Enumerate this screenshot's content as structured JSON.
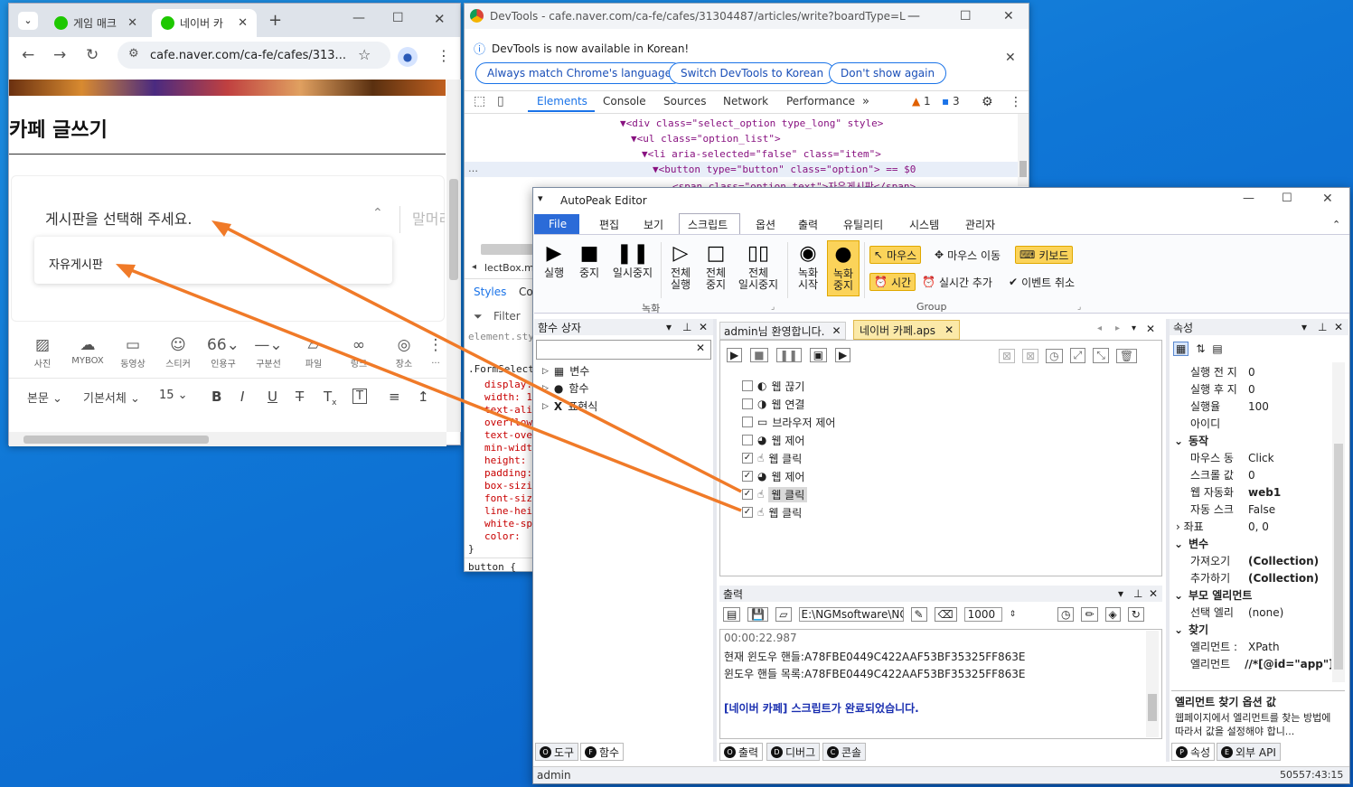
{
  "chrome": {
    "tab1": "게임 매크",
    "tab2": "네이버 카",
    "url": "cafe.naver.com/ca-fe/cafes/313...",
    "page_title": "카페 글쓰기",
    "board_placeholder": "게시판을 선택해 주세요.",
    "side_text": "말머리",
    "dropdown_option": "자유게시판",
    "tools": [
      "사진",
      "MYBOX",
      "동영상",
      "스티커",
      "인용구",
      "구분선",
      "파일",
      "링크",
      "장소",
      "..."
    ],
    "format": {
      "style": "본문",
      "font": "기본서체",
      "size": "15"
    }
  },
  "devtools": {
    "title": "DevTools - cafe.naver.com/ca-fe/cafes/31304487/articles/write?boardType=L",
    "notice": "DevTools is now available in Korean!",
    "btn1": "Always match Chrome's language",
    "btn2": "Switch DevTools to Korean",
    "btn3": "Don't show again",
    "tabs": [
      "Elements",
      "Console",
      "Sources",
      "Network",
      "Performance"
    ],
    "warn_count": "1",
    "msg_count": "3",
    "code": [
      "▼<div class=\"select_option type_long\" style>",
      "▼<ul class=\"option_list\">",
      "▼<li aria-selected=\"false\" class=\"item\">",
      "▼<button type=\"button\" class=\"option\"> == $0",
      "<span class=\"option_text\">자유게시판</span>"
    ],
    "crumb": "lectBox.m",
    "styles_tab": "Styles",
    "co_tab": "Co",
    "filter": "Filter",
    "element_style": "element.styl",
    "selector": ".FormSelectB",
    "css_props": [
      "display:",
      "width: 10",
      "text-alig",
      "overflow:",
      "text-over",
      "min-width",
      "height: ",
      "padding:",
      "box-sizin",
      "font-size",
      "line-heig",
      "white-spa",
      "color: "
    ],
    "close_brace": "}",
    "button_rule": "button {"
  },
  "autopeak": {
    "title": "AutoPeak Editor",
    "menu": [
      "File",
      "편집",
      "보기",
      "스크립트",
      "옵션",
      "출력",
      "유틸리티",
      "시스템",
      "관리자"
    ],
    "ribbon": {
      "run": "실행",
      "stop": "중지",
      "pause": "일시중지",
      "all_run": "전체\n실행",
      "all_stop": "전체\n중지",
      "all_pause": "전체\n일시중지",
      "rec_start": "녹화\n시작",
      "rec_stop": "녹화\n중지",
      "mouse": "마우스",
      "mouse_move": "마우스 이동",
      "keyboard": "키보드",
      "time": "시간",
      "realtime_add": "실시간 추가",
      "event_cancel": "이벤트 취소",
      "group_rec": "녹화",
      "group_group": "Group"
    },
    "func_box": {
      "title": "함수 상자",
      "items": [
        "변수",
        "함수",
        "표현식"
      ]
    },
    "doc_tabs": [
      "admin님 환영합니다.",
      "네이버 카페.aps"
    ],
    "script_items": [
      {
        "label": "웹 끊기",
        "checked": false
      },
      {
        "label": "웹 연결",
        "checked": false
      },
      {
        "label": "브라우저 제어",
        "checked": false
      },
      {
        "label": "웹 제어",
        "checked": false
      },
      {
        "label": "웹 클릭",
        "checked": true
      },
      {
        "label": "웹 제어",
        "checked": true
      },
      {
        "label": "웹 클릭",
        "checked": true
      },
      {
        "label": "웹 클릭",
        "checked": true
      }
    ],
    "output": {
      "title": "출력",
      "path": "E:\\NGMsoftware\\NG",
      "count": "1000",
      "lines": [
        "00:00:22.987",
        "현재 윈도우 핸들:A78FBE0449C422AAF53BF35325FF863E",
        "윈도우 핸들 목록:A78FBE0449C422AAF53BF35325FF863E",
        "",
        "[네이버 카페] 스크립트가 완료되었습니다."
      ]
    },
    "props": {
      "title": "속성",
      "rows_top": [
        [
          "실행 전 지",
          "0"
        ],
        [
          "실행 후 지",
          "0"
        ],
        [
          "실행율",
          "100"
        ],
        [
          "아이디",
          ""
        ]
      ],
      "cat_action": "동작",
      "rows_action": [
        [
          "마우스 동",
          "Click"
        ],
        [
          "스크롤 값",
          "0"
        ],
        [
          "웹 자동화",
          "web1"
        ],
        [
          "자동 스크",
          "False"
        ]
      ],
      "coord": [
        "좌표",
        "0, 0"
      ],
      "cat_var": "변수",
      "rows_var": [
        [
          "가져오기",
          "(Collection)"
        ],
        [
          "추가하기",
          "(Collection)"
        ]
      ],
      "cat_parent": "부모 엘리먼트",
      "rows_parent": [
        [
          "선택 엘리",
          "(none)"
        ]
      ],
      "cat_find": "찾기",
      "rows_find": [
        [
          "엘리먼트 :",
          "XPath"
        ],
        [
          "엘리먼트",
          "//*[@id=\"app\"]/"
        ]
      ],
      "desc_title": "엘리먼트 찾기 옵션 값",
      "desc_text": "웹페이지에서 엘리먼트를 찾는 방법에 따라서 값을 설정해야 합니..."
    },
    "bottom_tabs": {
      "left": [
        "도구",
        "함수"
      ],
      "mid": [
        "출력",
        "디버그",
        "콘솔"
      ],
      "right": [
        "속성",
        "외부 API"
      ]
    },
    "status": {
      "user": "admin",
      "time": "50557:43:15"
    }
  },
  "colors": {
    "accent": "#1a73e8",
    "arrow": "#f07a28",
    "highlight": "#fbd35a"
  }
}
